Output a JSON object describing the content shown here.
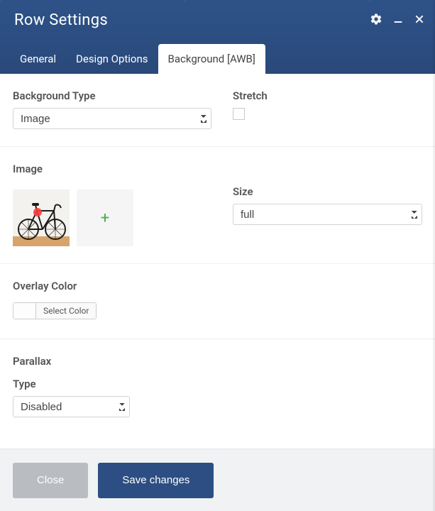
{
  "header": {
    "title": "Row Settings"
  },
  "tabs": [
    {
      "label": "General"
    },
    {
      "label": "Design Options"
    },
    {
      "label": "Background [AWB]"
    }
  ],
  "fields": {
    "bg_type_label": "Background Type",
    "bg_type_value": "Image",
    "stretch_label": "Stretch",
    "image_heading": "Image",
    "size_label": "Size",
    "size_value": "full",
    "overlay_heading": "Overlay Color",
    "select_color_label": "Select Color",
    "parallax_heading": "Parallax",
    "parallax_type_label": "Type",
    "parallax_type_value": "Disabled"
  },
  "footer": {
    "close": "Close",
    "save": "Save changes"
  },
  "icons": {
    "gear": "gear-icon",
    "minimize": "minimize-icon",
    "close": "close-icon",
    "add": "+"
  }
}
